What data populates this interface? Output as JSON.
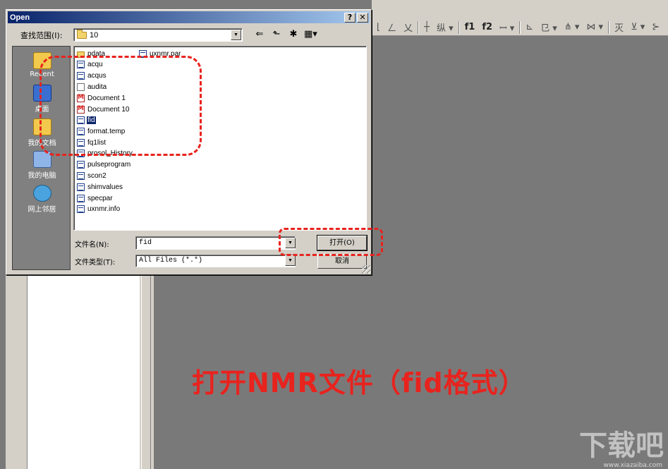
{
  "dialog": {
    "title": "Open",
    "help_button": "?",
    "close_button": "✕",
    "look_in_label": "查找范围(I):",
    "look_in_value": "10",
    "places": [
      {
        "label": "Recent"
      },
      {
        "label": "桌面"
      },
      {
        "label": "我的文档"
      },
      {
        "label": "我的电脑"
      },
      {
        "label": "网上邻居"
      }
    ],
    "files_col1": [
      {
        "name": "pdata",
        "icon": "folder-icon"
      },
      {
        "name": "acqu",
        "icon": "data-file-icon"
      },
      {
        "name": "acqus",
        "icon": "data-file-icon"
      },
      {
        "name": "audita",
        "icon": "text-file-icon"
      },
      {
        "name": "Document 1",
        "icon": "mnova-document-icon"
      },
      {
        "name": "Document 10",
        "icon": "mnova-document-icon"
      },
      {
        "name": "fid",
        "icon": "data-file-icon",
        "selected": true
      },
      {
        "name": "format.temp",
        "icon": "data-file-icon"
      },
      {
        "name": "fq1list",
        "icon": "data-file-icon"
      },
      {
        "name": "prosol_History",
        "icon": "data-file-icon"
      },
      {
        "name": "pulseprogram",
        "icon": "data-file-icon"
      },
      {
        "name": "scon2",
        "icon": "data-file-icon"
      },
      {
        "name": "shimvalues",
        "icon": "data-file-icon"
      },
      {
        "name": "specpar",
        "icon": "data-file-icon"
      },
      {
        "name": "uxnmr.info",
        "icon": "data-file-icon"
      }
    ],
    "files_col2": [
      {
        "name": "uxnmr.par",
        "icon": "data-file-icon"
      }
    ],
    "file_name_label": "文件名(N):",
    "file_name_value": "fid",
    "file_type_label": "文件类型(T):",
    "file_type_value": "All Files (*.*)",
    "open_button": "打开(O)",
    "cancel_button": "取消"
  },
  "app_toolbar": {
    "items": [
      "⌊",
      "ㄥ",
      "乂",
      "┼",
      "纵 ▾",
      "║",
      "f1",
      "f2",
      "ꟷ ▾",
      "⊾",
      "㔾 ▾",
      "⋔ ▾",
      "⋈ ▾",
      "灭",
      "⊻ ▾",
      "⊱"
    ]
  },
  "annotation": {
    "caption": "打开NMR文件（fid格式）",
    "color": "#e8231e"
  },
  "watermark": {
    "text": "下载吧",
    "url": "www.xiazaiba.com"
  }
}
